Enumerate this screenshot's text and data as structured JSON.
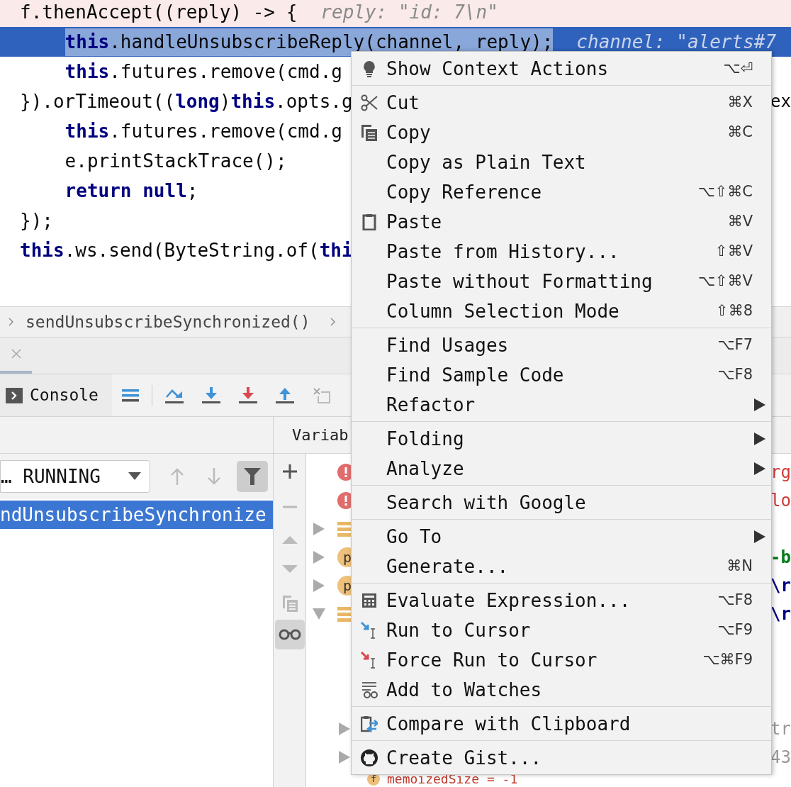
{
  "code_lines": [
    {
      "kind": "breakpoint",
      "segments": [
        {
          "kind": "plain",
          "text": "f.thenAccept((reply) -> {"
        }
      ],
      "hint": "reply: \"id: 7\\n\"",
      "children": [
        {
          "kind": "current",
          "segments": [
            {
              "kind": "keyword",
              "text": "this",
              "selected": true
            },
            {
              "kind": "plain",
              "text": ".handleUnsubscribeReply(channel, reply);",
              "selected": true
            }
          ],
          "hint": "channel: \"alerts#7"
        },
        {
          "kind": "normal",
          "segments": [
            {
              "kind": "keyword",
              "text": "this"
            },
            {
              "kind": "plain",
              "text": ".futures.remove(cmd.g"
            }
          ]
        }
      ]
    },
    {
      "kind": "normal",
      "segments": [
        {
          "kind": "plain",
          "text": "}).orTimeout(("
        },
        {
          "kind": "keyword",
          "text": "long"
        },
        {
          "kind": "plain",
          "text": ")"
        },
        {
          "kind": "keyword",
          "text": "this"
        },
        {
          "kind": "plain",
          "text": ".opts.g"
        }
      ],
      "tail": "ex",
      "children": [
        {
          "kind": "normal",
          "segments": [
            {
              "kind": "keyword",
              "text": "this"
            },
            {
              "kind": "plain",
              "text": ".futures.remove(cmd.g"
            }
          ]
        },
        {
          "kind": "normal",
          "segments": [
            {
              "kind": "plain",
              "text": "e.printStackTrace();"
            }
          ]
        },
        {
          "kind": "normal",
          "segments": [
            {
              "kind": "keyword",
              "text": "return null"
            },
            {
              "kind": "plain",
              "text": ";"
            }
          ]
        }
      ]
    },
    {
      "kind": "normal",
      "segments": [
        {
          "kind": "plain",
          "text": "});"
        }
      ]
    },
    {
      "kind": "normal",
      "segments": [
        {
          "kind": "keyword",
          "text": "this"
        },
        {
          "kind": "plain",
          "text": ".ws.send(ByteString.of("
        },
        {
          "kind": "keyword",
          "text": "thi"
        }
      ]
    }
  ],
  "breadcrumb": {
    "items": [
      "sendUnsubscribeSynchronized()"
    ]
  },
  "debug_toolbar": {
    "console_tab": "Console"
  },
  "frames": {
    "thread_dropdown": "… RUNNING",
    "filter_on": true,
    "items": [
      {
        "label": "ndUnsubscribeSynchronize",
        "selected": true
      }
    ]
  },
  "variables": {
    "header": "Variab",
    "watches_on": true,
    "rows": [
      {
        "kind": "error",
        "value": {
          "kind": "error",
          "text": "rg"
        }
      },
      {
        "kind": "error",
        "value": {
          "kind": "error",
          "text": "lo"
        }
      },
      {
        "kind": "list",
        "expanded": false
      },
      {
        "kind": "property",
        "badge": "p",
        "expanded": false,
        "value": {
          "kind": "string",
          "text": "-b"
        }
      },
      {
        "kind": "property",
        "badge": "p",
        "expanded": false,
        "value": {
          "kind": "escape",
          "text": "\\r"
        }
      },
      {
        "kind": "list",
        "expanded": true,
        "value": {
          "kind": "escape",
          "text": "\\r"
        },
        "children": [
          {
            "kind": "hidden",
            "expanded": false,
            "value": {
              "kind": "muted",
              "text": "tr"
            }
          },
          {
            "kind": "hidden",
            "expanded": false,
            "value": {
              "kind": "muted",
              "text": "43"
            }
          },
          {
            "kind": "field",
            "badge": "f",
            "label": "memoizedSize = -1"
          }
        ]
      }
    ]
  },
  "context_menu": {
    "groups": [
      {
        "items": [
          {
            "label": "Show Context Actions",
            "shortcut": "⌥⏎"
          }
        ]
      },
      {
        "items": [
          {
            "label": "Cut",
            "shortcut": "⌘X"
          },
          {
            "label": "Copy",
            "shortcut": "⌘C"
          },
          {
            "label": "Copy as Plain Text"
          },
          {
            "label": "Copy Reference",
            "shortcut": "⌥⇧⌘C"
          },
          {
            "label": "Paste",
            "shortcut": "⌘V"
          },
          {
            "label": "Paste from History...",
            "shortcut": "⇧⌘V"
          },
          {
            "label": "Paste without Formatting",
            "shortcut": "⌥⇧⌘V"
          },
          {
            "label": "Column Selection Mode",
            "shortcut": "⇧⌘8"
          }
        ]
      },
      {
        "items": [
          {
            "label": "Find Usages",
            "shortcut": "⌥F7"
          },
          {
            "label": "Find Sample Code",
            "shortcut": "⌥F8"
          },
          {
            "label": "Refactor",
            "submenu": true
          }
        ]
      },
      {
        "items": [
          {
            "label": "Folding",
            "submenu": true
          },
          {
            "label": "Analyze",
            "submenu": true
          }
        ]
      },
      {
        "items": [
          {
            "label": "Search with Google"
          }
        ]
      },
      {
        "items": [
          {
            "label": "Go To",
            "submenu": true
          },
          {
            "label": "Generate...",
            "shortcut": "⌘N"
          }
        ]
      },
      {
        "items": [
          {
            "label": "Evaluate Expression...",
            "shortcut": "⌥F8"
          },
          {
            "label": "Run to Cursor",
            "shortcut": "⌥F9"
          },
          {
            "label": "Force Run to Cursor",
            "shortcut": "⌥⌘F9"
          },
          {
            "label": "Add to Watches"
          }
        ]
      },
      {
        "items": [
          {
            "label": "Compare with Clipboard"
          }
        ]
      },
      {
        "items": [
          {
            "label": "Create Gist..."
          }
        ]
      }
    ]
  }
}
